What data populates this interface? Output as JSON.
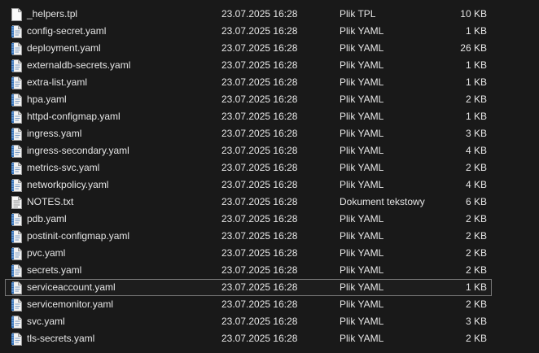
{
  "files": [
    {
      "name": "_helpers.tpl",
      "date": "23.07.2025 16:28",
      "type": "Plik TPL",
      "size": "10 KB",
      "icon": "plain-file-icon"
    },
    {
      "name": "config-secret.yaml",
      "date": "23.07.2025 16:28",
      "type": "Plik YAML",
      "size": "1 KB",
      "icon": "yaml-file-icon"
    },
    {
      "name": "deployment.yaml",
      "date": "23.07.2025 16:28",
      "type": "Plik YAML",
      "size": "26 KB",
      "icon": "yaml-file-icon"
    },
    {
      "name": "externaldb-secrets.yaml",
      "date": "23.07.2025 16:28",
      "type": "Plik YAML",
      "size": "1 KB",
      "icon": "yaml-file-icon"
    },
    {
      "name": "extra-list.yaml",
      "date": "23.07.2025 16:28",
      "type": "Plik YAML",
      "size": "1 KB",
      "icon": "yaml-file-icon"
    },
    {
      "name": "hpa.yaml",
      "date": "23.07.2025 16:28",
      "type": "Plik YAML",
      "size": "2 KB",
      "icon": "yaml-file-icon"
    },
    {
      "name": "httpd-configmap.yaml",
      "date": "23.07.2025 16:28",
      "type": "Plik YAML",
      "size": "1 KB",
      "icon": "yaml-file-icon"
    },
    {
      "name": "ingress.yaml",
      "date": "23.07.2025 16:28",
      "type": "Plik YAML",
      "size": "3 KB",
      "icon": "yaml-file-icon"
    },
    {
      "name": "ingress-secondary.yaml",
      "date": "23.07.2025 16:28",
      "type": "Plik YAML",
      "size": "4 KB",
      "icon": "yaml-file-icon"
    },
    {
      "name": "metrics-svc.yaml",
      "date": "23.07.2025 16:28",
      "type": "Plik YAML",
      "size": "2 KB",
      "icon": "yaml-file-icon"
    },
    {
      "name": "networkpolicy.yaml",
      "date": "23.07.2025 16:28",
      "type": "Plik YAML",
      "size": "4 KB",
      "icon": "yaml-file-icon"
    },
    {
      "name": "NOTES.txt",
      "date": "23.07.2025 16:28",
      "type": "Dokument tekstowy",
      "size": "6 KB",
      "icon": "text-file-icon"
    },
    {
      "name": "pdb.yaml",
      "date": "23.07.2025 16:28",
      "type": "Plik YAML",
      "size": "2 KB",
      "icon": "yaml-file-icon"
    },
    {
      "name": "postinit-configmap.yaml",
      "date": "23.07.2025 16:28",
      "type": "Plik YAML",
      "size": "2 KB",
      "icon": "yaml-file-icon"
    },
    {
      "name": "pvc.yaml",
      "date": "23.07.2025 16:28",
      "type": "Plik YAML",
      "size": "2 KB",
      "icon": "yaml-file-icon"
    },
    {
      "name": "secrets.yaml",
      "date": "23.07.2025 16:28",
      "type": "Plik YAML",
      "size": "2 KB",
      "icon": "yaml-file-icon"
    },
    {
      "name": "serviceaccount.yaml",
      "date": "23.07.2025 16:28",
      "type": "Plik YAML",
      "size": "1 KB",
      "icon": "yaml-file-icon",
      "selected": true
    },
    {
      "name": "servicemonitor.yaml",
      "date": "23.07.2025 16:28",
      "type": "Plik YAML",
      "size": "2 KB",
      "icon": "yaml-file-icon"
    },
    {
      "name": "svc.yaml",
      "date": "23.07.2025 16:28",
      "type": "Plik YAML",
      "size": "3 KB",
      "icon": "yaml-file-icon"
    },
    {
      "name": "tls-secrets.yaml",
      "date": "23.07.2025 16:28",
      "type": "Plik YAML",
      "size": "2 KB",
      "icon": "yaml-file-icon"
    }
  ]
}
